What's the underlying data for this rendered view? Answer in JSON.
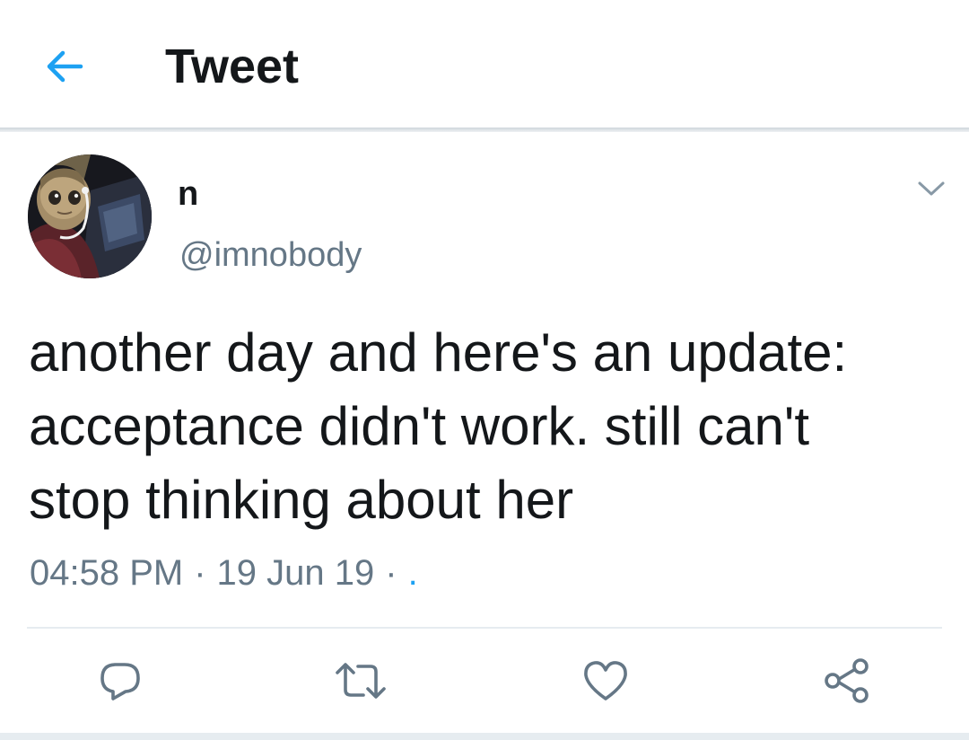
{
  "header": {
    "title": "Tweet",
    "back_icon": "arrow-left-icon",
    "accent_color": "#1da1f2"
  },
  "tweet": {
    "display_name": "n",
    "handle": "@imnobody",
    "text": "another day and here's an update:\nacceptance didn't work. still can't\nstop thinking about her",
    "time": "04:58 PM",
    "date": "19 Jun 19",
    "separator": "·",
    "client": "."
  },
  "actions": {
    "reply_icon": "reply-icon",
    "retweet_icon": "retweet-icon",
    "like_icon": "heart-icon",
    "share_icon": "share-icon"
  },
  "colors": {
    "text_primary": "#14171a",
    "text_secondary": "#657786",
    "icon_gray": "#657786",
    "divider": "#e6ecf0"
  }
}
